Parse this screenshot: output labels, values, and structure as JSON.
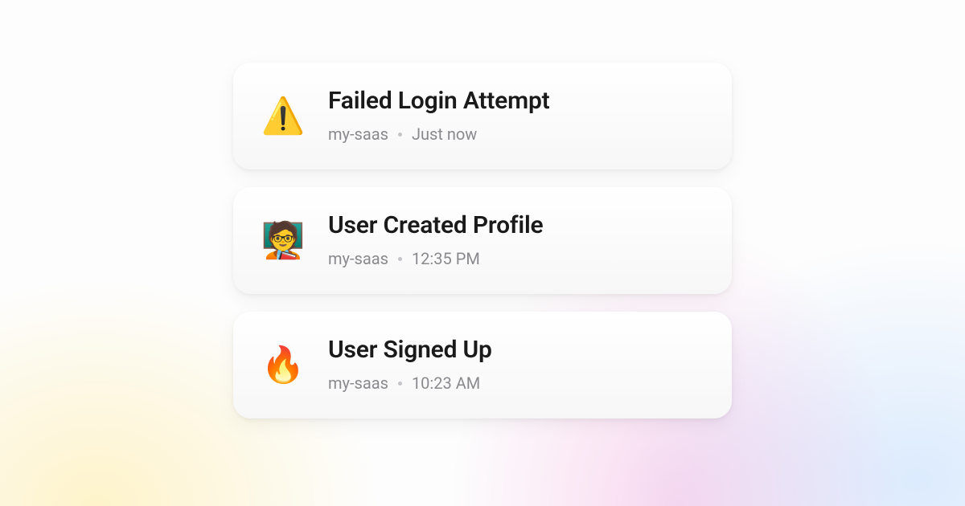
{
  "events": [
    {
      "icon": "⚠️",
      "icon_name": "warning-icon",
      "title": "Failed Login Attempt",
      "source": "my-saas",
      "time": "Just now"
    },
    {
      "icon": "🧑‍🏫",
      "icon_name": "teacher-icon",
      "title": "User Created Profile",
      "source": "my-saas",
      "time": "12:35 PM"
    },
    {
      "icon": "🔥",
      "icon_name": "fire-icon",
      "title": "User Signed Up",
      "source": "my-saas",
      "time": "10:23 AM"
    }
  ]
}
